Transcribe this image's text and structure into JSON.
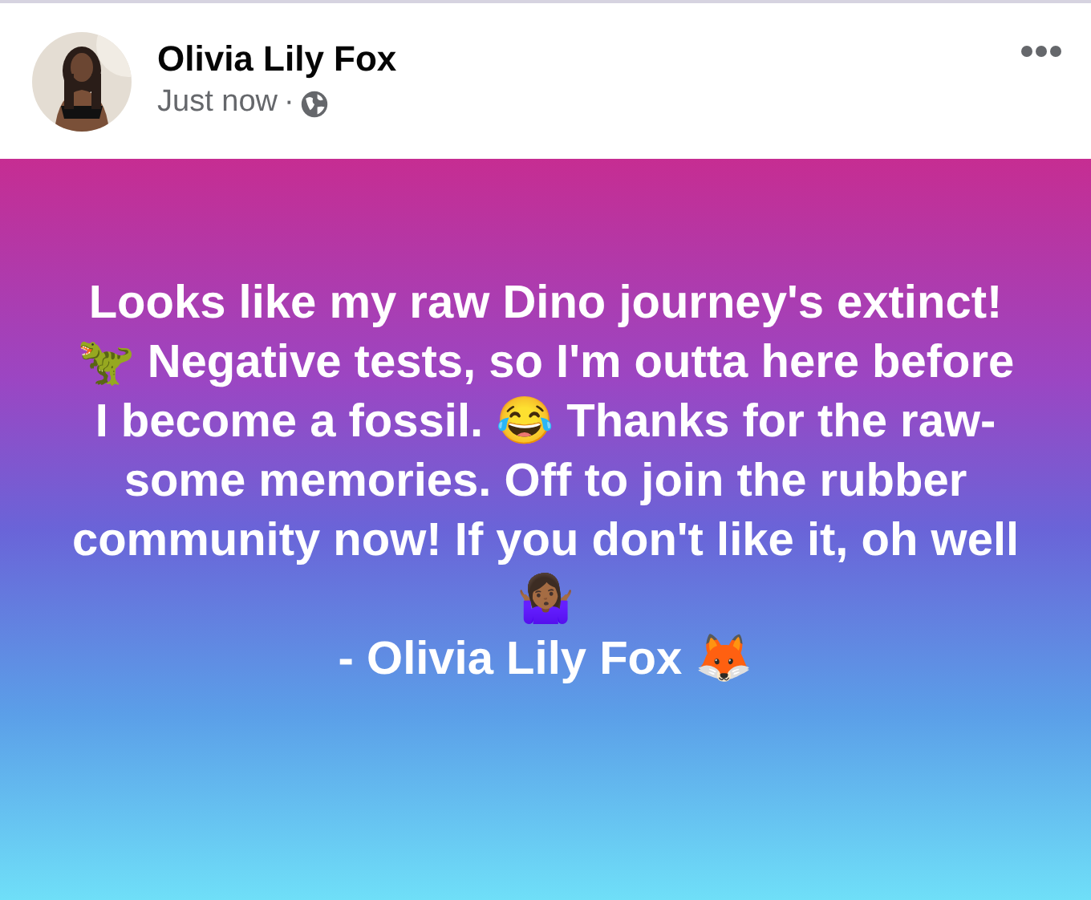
{
  "post": {
    "author": "Olivia Lily Fox",
    "time": "Just now",
    "separator": "·",
    "body": "Looks like my raw Dino journey's extinct! 🦖 Negative tests, so I'm outta here before I become a fossil. 😂 Thanks for the raw-some memories. Off to join the rubber community now! If you don't like it, oh well 🤷🏾‍♀️",
    "signature": "- Olivia Lily Fox 🦊"
  }
}
